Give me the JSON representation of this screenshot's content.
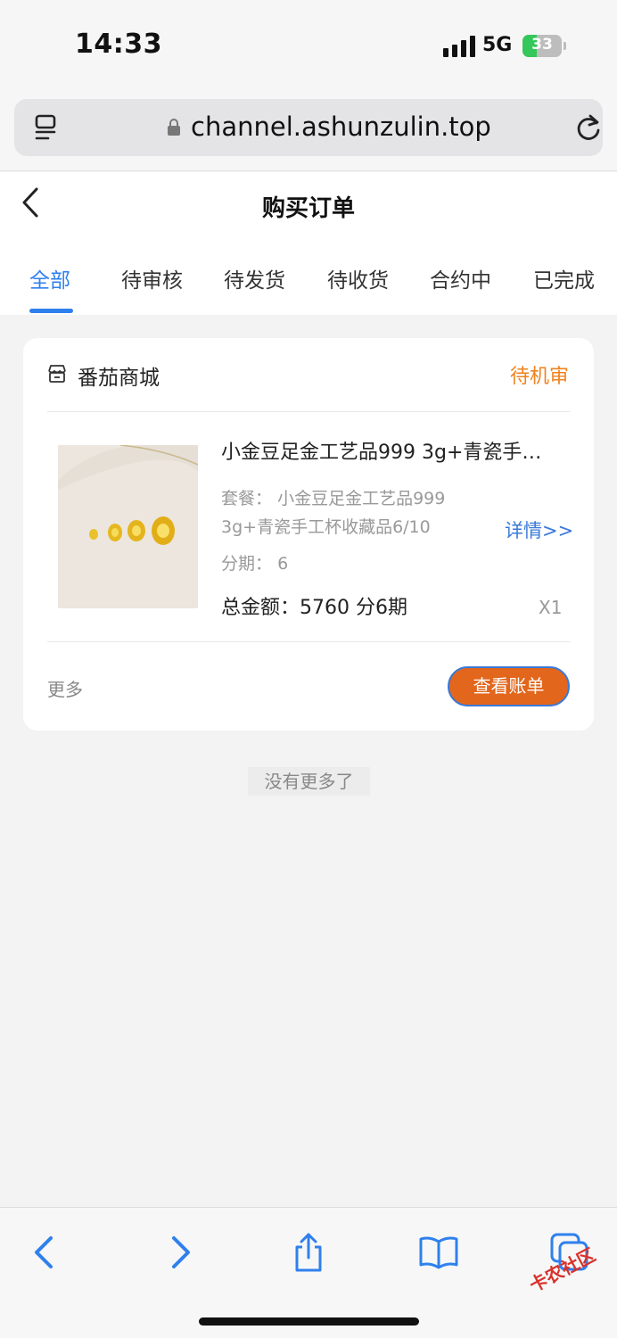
{
  "status_bar": {
    "time": "14:33",
    "network": "5G",
    "battery": "33"
  },
  "browser": {
    "url": "channel.ashunzulin.top"
  },
  "header": {
    "title": "购买订单"
  },
  "tabs": [
    {
      "label": "全部",
      "active": true
    },
    {
      "label": "待审核"
    },
    {
      "label": "待发货"
    },
    {
      "label": "待收货"
    },
    {
      "label": "合约中"
    },
    {
      "label": "已完成"
    }
  ],
  "order": {
    "shop": "番茄商城",
    "status": "待机审",
    "title": "小金豆足金工艺品999 3g+青瓷手工杯收藏品6/10",
    "package_label": "套餐：",
    "package_line1": "小金豆足金工艺品999",
    "package_line2": "3g+青瓷手工杯收藏品6/10",
    "detail_link": "详情>>",
    "installments_label": "分期：",
    "installments_value": "6",
    "total": "总金额：5760 分6期",
    "qty": "X1",
    "more": "更多",
    "bill_button": "查看账单"
  },
  "footer_text": "没有更多了",
  "watermark": "卡农社区",
  "colors": {
    "accent_blue": "#2f80ed",
    "status_orange": "#f0821e",
    "button_orange": "#e2661c",
    "battery_green": "#34c759"
  }
}
